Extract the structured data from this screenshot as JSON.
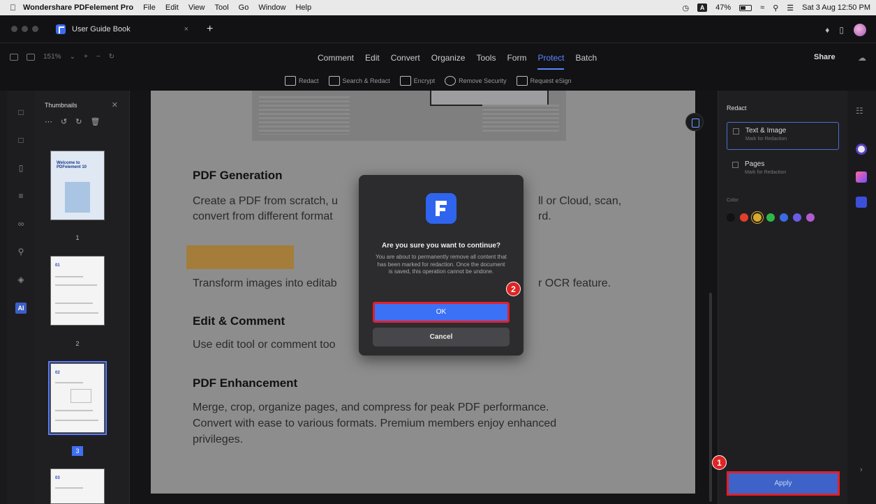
{
  "menubar": {
    "app_name": "Wondershare PDFelement Pro",
    "items": [
      "File",
      "Edit",
      "View",
      "Tool",
      "Go",
      "Window",
      "Help"
    ],
    "keyboard_badge": "A",
    "battery": "47%",
    "datetime": "Sat 3 Aug  12:50 PM"
  },
  "tabbar": {
    "doc_title": "User Guide Book",
    "close_glyph": "×",
    "new_tab_glyph": "+"
  },
  "toolbar": {
    "zoom": "151%",
    "tabs": [
      "Comment",
      "Edit",
      "Convert",
      "Organize",
      "Tools",
      "Form",
      "Protect",
      "Batch"
    ],
    "active_tab": "Protect",
    "share_label": "Share"
  },
  "subtoolbar": {
    "items": [
      "Redact",
      "Search & Redact",
      "Encrypt",
      "Remove Security",
      "Request eSign"
    ]
  },
  "thumbnails": {
    "title": "Thumbnails",
    "pages": [
      {
        "number": "1",
        "heading": "Welcome to PDFelement 10"
      },
      {
        "number": "2",
        "heading": "01"
      },
      {
        "number": "3",
        "heading": "02"
      },
      {
        "number": "",
        "heading": "03"
      }
    ],
    "selected_page": "3"
  },
  "document": {
    "sections": [
      {
        "heading": "PDF Generation",
        "body": "Create a PDF from scratch, u",
        "body_right": "ll or Cloud, scan,",
        "body2": "convert from different format",
        "body2_right": "rd."
      },
      {
        "heading": "",
        "body": "Transform images into editab",
        "body_right": "r OCR feature."
      },
      {
        "heading": "Edit & Comment",
        "body": "Use edit tool or comment too"
      },
      {
        "heading": "PDF Enhancement",
        "body": "Merge, crop, organize pages, and compress for peak PDF performance.",
        "body2": "Convert with ease to various formats. Premium members enjoy enhanced",
        "body3": "privileges."
      }
    ]
  },
  "dialog": {
    "question": "Are you sure you want to continue?",
    "message": "You are about to permanently remove all content that has been marked for redaction. Once the document is saved, this operation cannot be undone.",
    "ok_label": "OK",
    "cancel_label": "Cancel",
    "step_badge": "2"
  },
  "redact_panel": {
    "title": "Redact",
    "options": [
      {
        "label": "Text & Image",
        "sublabel": "Mark for Redaction",
        "selected": true
      },
      {
        "label": "Pages",
        "sublabel": "Mark for Redaction",
        "selected": false
      }
    ],
    "color_label": "Color",
    "colors": [
      "#111111",
      "#e0402b",
      "#d9a92c",
      "#2fb84a",
      "#3b6be0",
      "#6a5ce6",
      "#b05ccf"
    ],
    "selected_color": "#d9a92c",
    "apply_label": "Apply",
    "step_badge": "1"
  }
}
